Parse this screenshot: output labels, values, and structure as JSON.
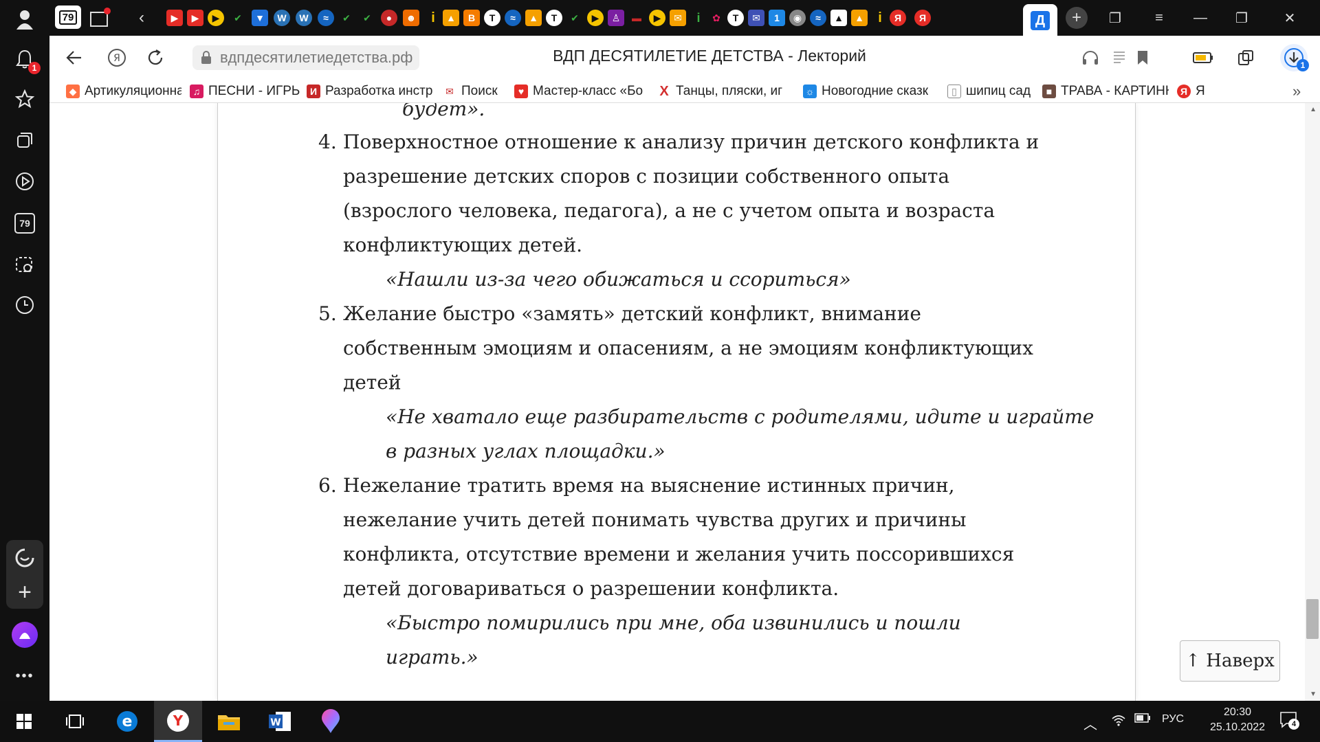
{
  "tabstrip": {
    "tab_count": "79",
    "active_tab_letter": "Д"
  },
  "sidebar": {
    "notifications_badge": "1",
    "tabs_count": "79"
  },
  "addressbar": {
    "url": "вдпдесятилетиедетства.рф",
    "title": "ВДП ДЕСЯТИЛЕТИЕ ДЕТСТВА - Лекторий",
    "downloads_badge": "1"
  },
  "bookmarks": [
    "Артикуляционная",
    "ПЕСНИ - ИГРЫ Д/",
    "Разработка инстр",
    "Поиск",
    "Мастер-класс «Бо",
    "Танцы, пляски, иг",
    "Новогодние сказк",
    "шипиц сад",
    "ТРАВА - КАРТИНК",
    "Я"
  ],
  "lecture": {
    "line0": "будет».",
    "item4": {
      "number": "4.",
      "lines": [
        "Поверхностное отношение к анализу причин детского конфликта и",
        "разрешение детских споров с позиции собственного опыта",
        "(взрослого человека, педагога), а не с учетом опыта и возраста",
        "конфликтующих детей."
      ],
      "quote": [
        "«Нашли из-за чего обижаться и ссориться»"
      ]
    },
    "item5": {
      "number": "5.",
      "lines": [
        "Желание быстро «замять» детский конфликт, внимание",
        "собственным эмоциям и опасениям, а не эмоциям конфликтующих",
        "детей"
      ],
      "quote": [
        "«Не хватало еще разбирательств с родителями, идите и играйте",
        "в разных углах площадки.»"
      ]
    },
    "item6": {
      "number": "6.",
      "lines": [
        "Нежелание тратить время на выяснение истинных причин,",
        "нежелание учить детей понимать чувства других и причины",
        "конфликта, отсутствие времени и желания учить поссорившихся",
        "детей договариваться о разрешении конфликта."
      ],
      "quote": [
        "«Быстро помирились при мне, оба извинились и пошли",
        "играть.»"
      ]
    },
    "to_top_label": "↑ Наверх"
  },
  "taskbar": {
    "lang": "РУС",
    "time": "20:30",
    "date": "25.10.2022",
    "notif_count": "4"
  },
  "colors": {
    "browser_dark": "#111111",
    "accent_blue": "#1a73e8",
    "badge_red": "#e8242c"
  }
}
